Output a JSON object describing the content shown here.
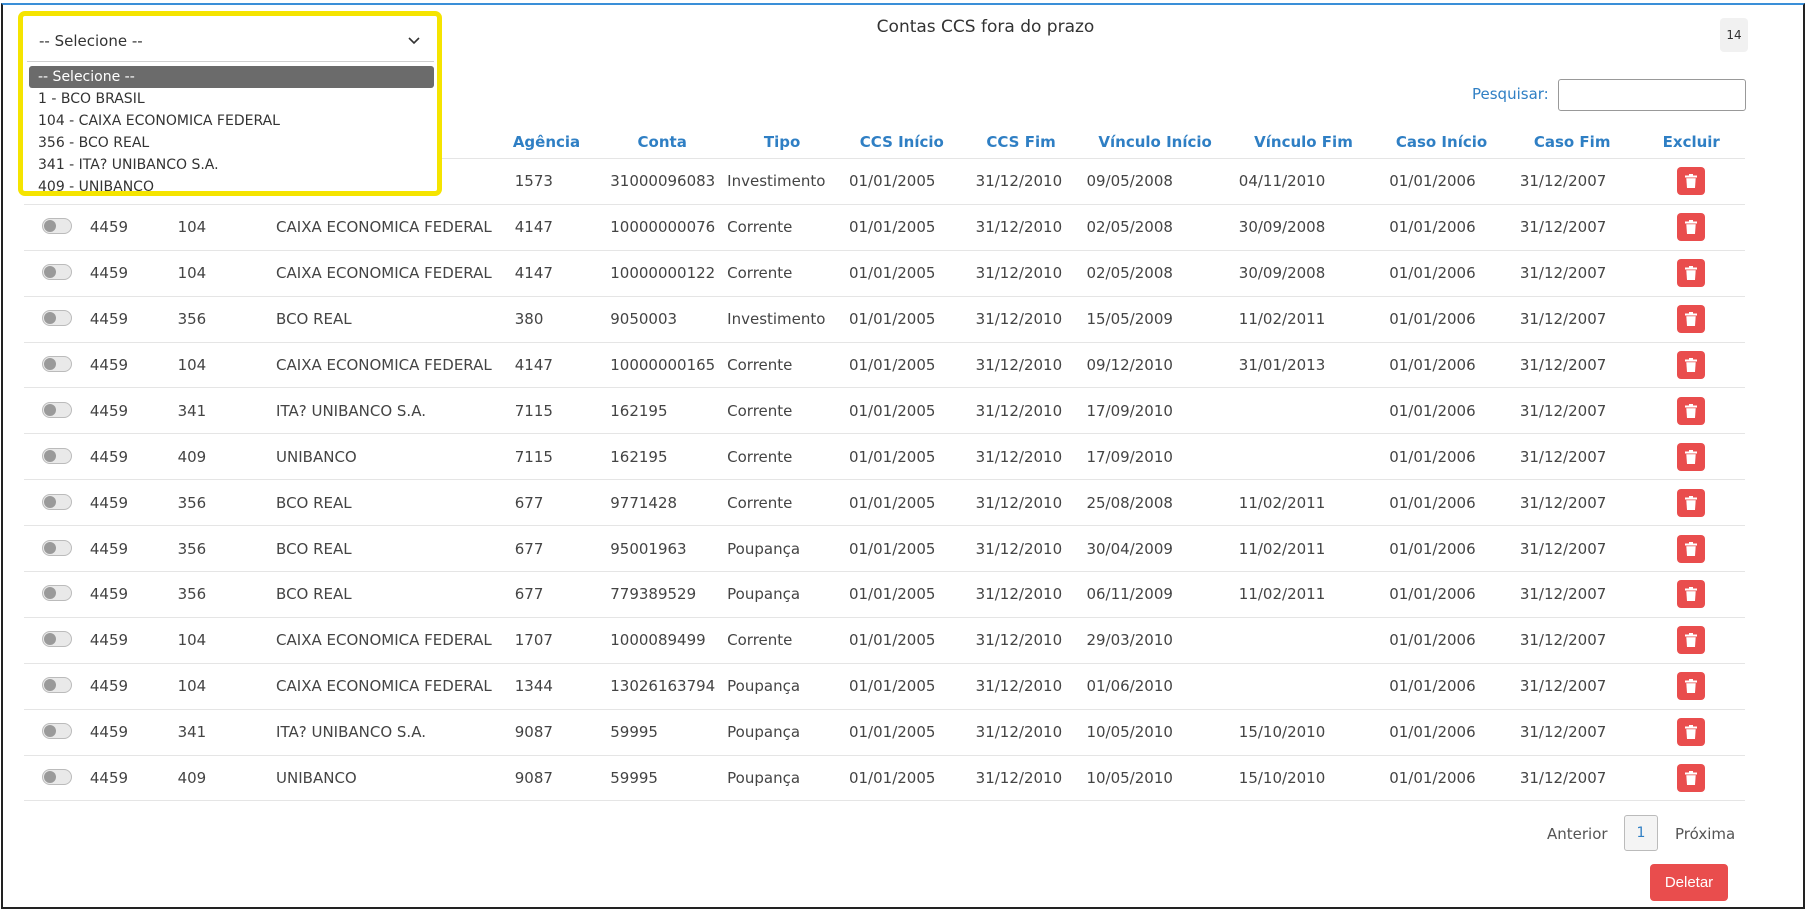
{
  "header": {
    "title": "Contas CCS fora do prazo",
    "count": "14"
  },
  "search": {
    "label": "Pesquisar:",
    "value": ""
  },
  "select": {
    "current": "-- Selecione --",
    "options": [
      "-- Selecione --",
      "1 - BCO BRASIL",
      "104 - CAIXA ECONOMICA FEDERAL",
      "356 - BCO REAL",
      "341 - ITA? UNIBANCO S.A.",
      "409 - UNIBANCO"
    ]
  },
  "table": {
    "headers": [
      "",
      "",
      "",
      "",
      "Agência",
      "Conta",
      "Tipo",
      "CCS Início",
      "CCS Fim",
      "Vínculo Início",
      "Vínculo Fim",
      "Caso Início",
      "Caso Fim",
      "Excluir"
    ],
    "rows": [
      {
        "caso": "",
        "banco": "",
        "nome": "",
        "agencia": "1573",
        "conta": "31000096083",
        "tipo": "Investimento",
        "ccs_inicio": "01/01/2005",
        "ccs_fim": "31/12/2010",
        "vinc_inicio": "09/05/2008",
        "vinc_fim": "04/11/2010",
        "caso_inicio": "01/01/2006",
        "caso_fim": "31/12/2007",
        "ccs_fim_red": true,
        "hidden_left": true
      },
      {
        "caso": "4459",
        "banco": "104",
        "nome": "CAIXA ECONOMICA FEDERAL",
        "agencia": "4147",
        "conta": "10000000076",
        "tipo": "Corrente",
        "ccs_inicio": "01/01/2005",
        "ccs_fim": "31/12/2010",
        "vinc_inicio": "02/05/2008",
        "vinc_fim": "30/09/2008",
        "caso_inicio": "01/01/2006",
        "caso_fim": "31/12/2007",
        "ccs_fim_red": true
      },
      {
        "caso": "4459",
        "banco": "104",
        "nome": "CAIXA ECONOMICA FEDERAL",
        "agencia": "4147",
        "conta": "10000000122",
        "tipo": "Corrente",
        "ccs_inicio": "01/01/2005",
        "ccs_fim": "31/12/2010",
        "vinc_inicio": "02/05/2008",
        "vinc_fim": "30/09/2008",
        "caso_inicio": "01/01/2006",
        "caso_fim": "31/12/2007",
        "ccs_fim_red": true
      },
      {
        "caso": "4459",
        "banco": "356",
        "nome": "BCO REAL",
        "agencia": "380",
        "conta": "9050003",
        "tipo": "Investimento",
        "ccs_inicio": "01/01/2005",
        "ccs_fim": "31/12/2010",
        "vinc_inicio": "15/05/2009",
        "vinc_fim": "11/02/2011",
        "caso_inicio": "01/01/2006",
        "caso_fim": "31/12/2007",
        "ccs_fim_red": false
      },
      {
        "caso": "4459",
        "banco": "104",
        "nome": "CAIXA ECONOMICA FEDERAL",
        "agencia": "4147",
        "conta": "10000000165",
        "tipo": "Corrente",
        "ccs_inicio": "01/01/2005",
        "ccs_fim": "31/12/2010",
        "vinc_inicio": "09/12/2010",
        "vinc_fim": "31/01/2013",
        "caso_inicio": "01/01/2006",
        "caso_fim": "31/12/2007",
        "ccs_fim_red": false
      },
      {
        "caso": "4459",
        "banco": "341",
        "nome": "ITA? UNIBANCO S.A.",
        "agencia": "7115",
        "conta": "162195",
        "tipo": "Corrente",
        "ccs_inicio": "01/01/2005",
        "ccs_fim": "31/12/2010",
        "vinc_inicio": "17/09/2010",
        "vinc_fim": "",
        "caso_inicio": "01/01/2006",
        "caso_fim": "31/12/2007",
        "ccs_fim_red": false
      },
      {
        "caso": "4459",
        "banco": "409",
        "nome": "UNIBANCO",
        "agencia": "7115",
        "conta": "162195",
        "tipo": "Corrente",
        "ccs_inicio": "01/01/2005",
        "ccs_fim": "31/12/2010",
        "vinc_inicio": "17/09/2010",
        "vinc_fim": "",
        "caso_inicio": "01/01/2006",
        "caso_fim": "31/12/2007",
        "ccs_fim_red": false
      },
      {
        "caso": "4459",
        "banco": "356",
        "nome": "BCO REAL",
        "agencia": "677",
        "conta": "9771428",
        "tipo": "Corrente",
        "ccs_inicio": "01/01/2005",
        "ccs_fim": "31/12/2010",
        "vinc_inicio": "25/08/2008",
        "vinc_fim": "11/02/2011",
        "caso_inicio": "01/01/2006",
        "caso_fim": "31/12/2007",
        "ccs_fim_red": false
      },
      {
        "caso": "4459",
        "banco": "356",
        "nome": "BCO REAL",
        "agencia": "677",
        "conta": "95001963",
        "tipo": "Poupança",
        "ccs_inicio": "01/01/2005",
        "ccs_fim": "31/12/2010",
        "vinc_inicio": "30/04/2009",
        "vinc_fim": "11/02/2011",
        "caso_inicio": "01/01/2006",
        "caso_fim": "31/12/2007",
        "ccs_fim_red": false
      },
      {
        "caso": "4459",
        "banco": "356",
        "nome": "BCO REAL",
        "agencia": "677",
        "conta": "779389529",
        "tipo": "Poupança",
        "ccs_inicio": "01/01/2005",
        "ccs_fim": "31/12/2010",
        "vinc_inicio": "06/11/2009",
        "vinc_fim": "11/02/2011",
        "caso_inicio": "01/01/2006",
        "caso_fim": "31/12/2007",
        "ccs_fim_red": false
      },
      {
        "caso": "4459",
        "banco": "104",
        "nome": "CAIXA ECONOMICA FEDERAL",
        "agencia": "1707",
        "conta": "1000089499",
        "tipo": "Corrente",
        "ccs_inicio": "01/01/2005",
        "ccs_fim": "31/12/2010",
        "vinc_inicio": "29/03/2010",
        "vinc_fim": "",
        "caso_inicio": "01/01/2006",
        "caso_fim": "31/12/2007",
        "ccs_fim_red": false
      },
      {
        "caso": "4459",
        "banco": "104",
        "nome": "CAIXA ECONOMICA FEDERAL",
        "agencia": "1344",
        "conta": "13026163794",
        "tipo": "Poupança",
        "ccs_inicio": "01/01/2005",
        "ccs_fim": "31/12/2010",
        "vinc_inicio": "01/06/2010",
        "vinc_fim": "",
        "caso_inicio": "01/01/2006",
        "caso_fim": "31/12/2007",
        "ccs_fim_red": false
      },
      {
        "caso": "4459",
        "banco": "341",
        "nome": "ITA? UNIBANCO S.A.",
        "agencia": "9087",
        "conta": "59995",
        "tipo": "Poupança",
        "ccs_inicio": "01/01/2005",
        "ccs_fim": "31/12/2010",
        "vinc_inicio": "10/05/2010",
        "vinc_fim": "15/10/2010",
        "caso_inicio": "01/01/2006",
        "caso_fim": "31/12/2007",
        "ccs_fim_red": true
      },
      {
        "caso": "4459",
        "banco": "409",
        "nome": "UNIBANCO",
        "agencia": "9087",
        "conta": "59995",
        "tipo": "Poupança",
        "ccs_inicio": "01/01/2005",
        "ccs_fim": "31/12/2010",
        "vinc_inicio": "10/05/2010",
        "vinc_fim": "15/10/2010",
        "caso_inicio": "01/01/2006",
        "caso_fim": "31/12/2007",
        "ccs_fim_red": true
      }
    ]
  },
  "pagination": {
    "prev": "Anterior",
    "current": "1",
    "next": "Próxima"
  },
  "actions": {
    "delete_label": "Deletar"
  },
  "colors": {
    "accent": "#2f7fc4",
    "danger": "#e94d4d",
    "highlight": "#f5e400",
    "date_red": "#e04848"
  }
}
